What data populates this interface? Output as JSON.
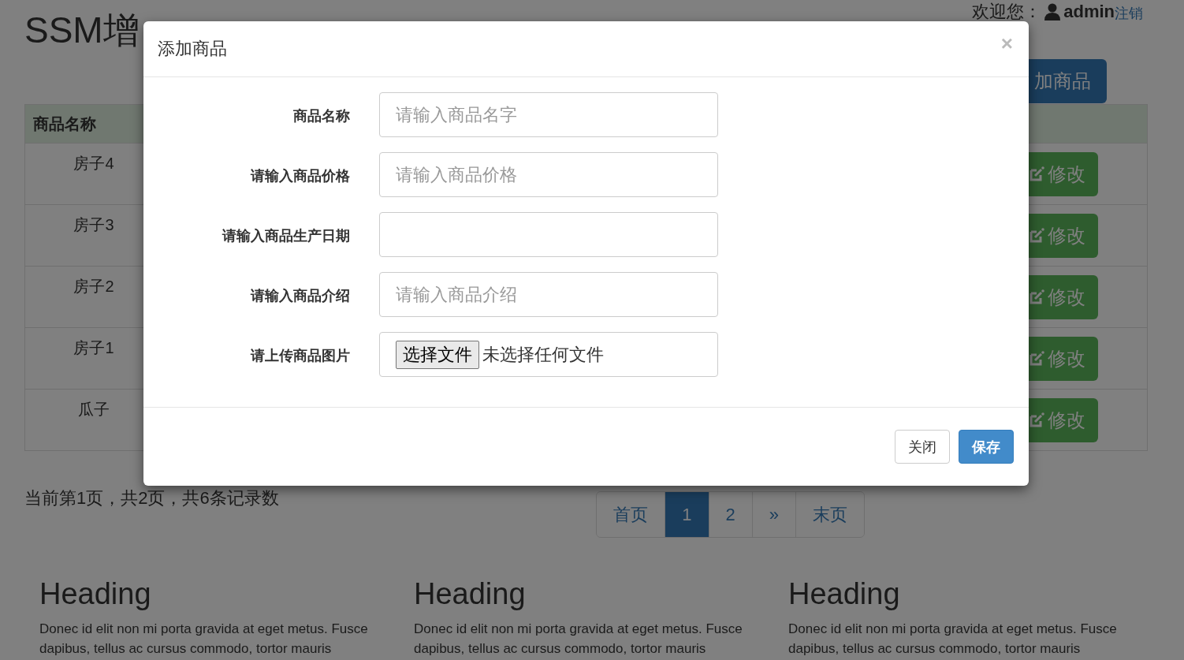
{
  "page": {
    "title": "SSM增",
    "user": {
      "greeting": "欢迎您：",
      "name": "admin",
      "logout": "注销"
    },
    "add_button": "加商品",
    "table": {
      "columns": [
        "商品名称"
      ],
      "rows": [
        {
          "name": "房子4",
          "action": "修改"
        },
        {
          "name": "房子3",
          "action": "修改"
        },
        {
          "name": "房子2",
          "action": "修改"
        },
        {
          "name": "房子1",
          "action": "修改"
        },
        {
          "name": "瓜子",
          "action": "修改"
        }
      ]
    },
    "page_info": "当前第1页，共2页，共6条记录数",
    "pagination": [
      {
        "label": "首页",
        "selected": false
      },
      {
        "label": "1",
        "selected": true
      },
      {
        "label": "2",
        "selected": false
      },
      {
        "label": "»",
        "selected": false
      },
      {
        "label": "末页",
        "selected": false
      }
    ],
    "features": [
      {
        "heading": "Heading",
        "text": "Donec id elit non mi porta gravida at eget metus. Fusce dapibus, tellus ac cursus commodo, tortor mauris"
      },
      {
        "heading": "Heading",
        "text": "Donec id elit non mi porta gravida at eget metus. Fusce dapibus, tellus ac cursus commodo, tortor mauris"
      },
      {
        "heading": "Heading",
        "text": "Donec id elit non mi porta gravida at eget metus. Fusce dapibus, tellus ac cursus commodo, tortor mauris"
      }
    ]
  },
  "modal": {
    "title": "添加商品",
    "close": "×",
    "fields": [
      {
        "label": "商品名称",
        "kind": "text",
        "placeholder": "请输入商品名字"
      },
      {
        "label": "请输入商品价格",
        "kind": "text",
        "placeholder": "请输入商品价格"
      },
      {
        "label": "请输入商品生产日期",
        "kind": "text"
      },
      {
        "label": "请输入商品介绍",
        "kind": "text",
        "placeholder": "请输入商品介绍"
      },
      {
        "label": "请上传商品图片",
        "kind": "file",
        "button": "选择文件",
        "value": "未选择任何文件"
      }
    ],
    "buttons": [
      {
        "label": "关闭",
        "kind": "default"
      },
      {
        "label": "保存",
        "kind": "primary"
      }
    ]
  }
}
